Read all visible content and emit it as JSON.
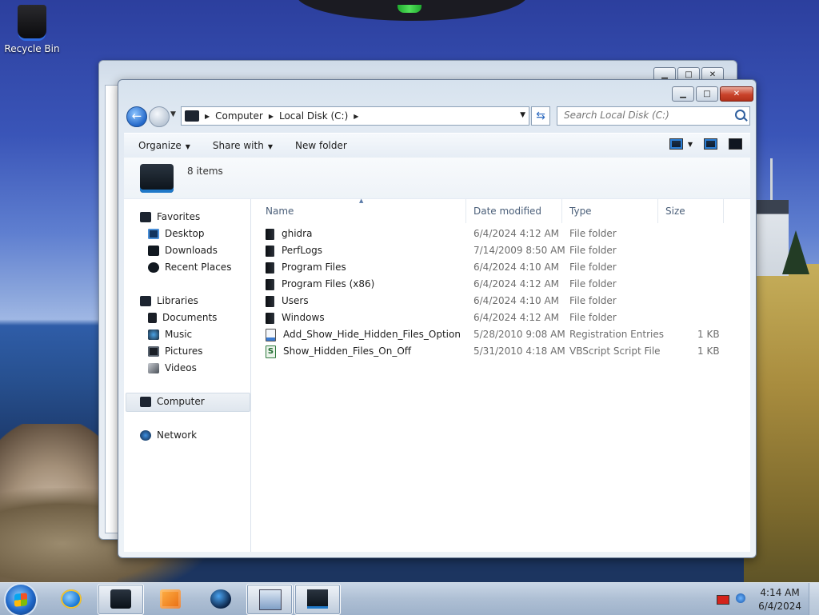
{
  "desktop": {
    "icons": [
      {
        "label": "Recycle Bin",
        "icon": "recycle-bin-icon"
      }
    ]
  },
  "window": {
    "caption_buttons": {
      "minimize": "▁",
      "maximize": "□",
      "close": "✕"
    },
    "nav": {
      "back": "←"
    },
    "breadcrumb": [
      "Computer",
      "Local Disk (C:)"
    ],
    "search": {
      "placeholder": "Search Local Disk (C:)"
    },
    "commands": {
      "organize": "Organize",
      "share_with": "Share with",
      "new_folder": "New folder"
    },
    "details": {
      "item_count": "8 items"
    },
    "nav_pane": {
      "favorites": {
        "label": "Favorites",
        "items": [
          "Desktop",
          "Downloads",
          "Recent Places"
        ]
      },
      "libraries": {
        "label": "Libraries",
        "items": [
          "Documents",
          "Music",
          "Pictures",
          "Videos"
        ]
      },
      "computer": "Computer",
      "network": "Network"
    },
    "columns": {
      "name": "Name",
      "date": "Date modified",
      "type": "Type",
      "size": "Size"
    },
    "files": [
      {
        "name": "ghidra",
        "date": "6/4/2024 4:12 AM",
        "type": "File folder",
        "size": "",
        "icon": "folder-icon"
      },
      {
        "name": "PerfLogs",
        "date": "7/14/2009 8:50 AM",
        "type": "File folder",
        "size": "",
        "icon": "folder-icon"
      },
      {
        "name": "Program Files",
        "date": "6/4/2024 4:10 AM",
        "type": "File folder",
        "size": "",
        "icon": "folder-icon"
      },
      {
        "name": "Program Files (x86)",
        "date": "6/4/2024 4:12 AM",
        "type": "File folder",
        "size": "",
        "icon": "folder-icon"
      },
      {
        "name": "Users",
        "date": "6/4/2024 4:10 AM",
        "type": "File folder",
        "size": "",
        "icon": "folder-icon"
      },
      {
        "name": "Windows",
        "date": "6/4/2024 4:12 AM",
        "type": "File folder",
        "size": "",
        "icon": "folder-icon"
      },
      {
        "name": "Add_Show_Hide_Hidden_Files_Option",
        "date": "5/28/2010 9:08 AM",
        "type": "Registration Entries",
        "size": "1 KB",
        "icon": "registry-file-icon"
      },
      {
        "name": "Show_Hidden_Files_On_Off",
        "date": "5/31/2010 4:18 AM",
        "type": "VBScript Script File",
        "size": "1 KB",
        "icon": "vbscript-file-icon"
      }
    ]
  },
  "taskbar": {
    "pinned": [
      "internet-explorer-icon",
      "explorer-icon",
      "media-player-icon",
      "network-globe-icon",
      "remote-desktop-icon",
      "drive-icon"
    ],
    "clock": {
      "time": "4:14 AM",
      "date": "6/4/2024"
    }
  },
  "colors": {
    "accent": "#2468c9",
    "selection": "#dfe6ee"
  }
}
